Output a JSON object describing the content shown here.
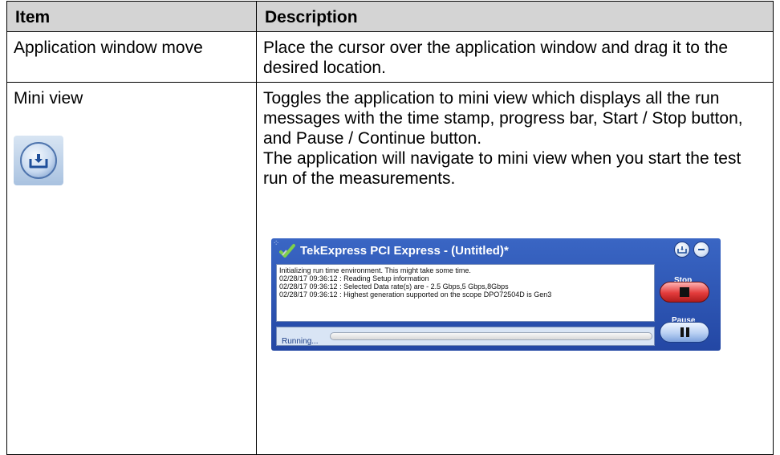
{
  "table": {
    "headers": [
      "Item",
      "Description"
    ],
    "rows": [
      {
        "item": "Application window move",
        "description": [
          "Place the cursor over the application window and drag it to the desired location."
        ]
      },
      {
        "item": "Mini view",
        "description": [
          "Toggles the application to mini view which displays all the run messages with the time stamp, progress bar, Start / Stop button, and Pause / Continue button.",
          "The application will navigate to mini view when you start the test run of the measurements."
        ]
      }
    ]
  },
  "mini_view": {
    "title": "TekExpress PCI Express  -  (Untitled)*",
    "messages": [
      "Initializing run time environment. This might take some time.",
      "02/28/17 09:36:12 : Reading Setup information",
      "02/28/17 09:36:12 : Selected Data rate(s) are - 2.5 Gbps,5 Gbps,8Gbps",
      "02/28/17 09:36:12 : Highest generation supported on the scope DPO72504D is Gen3"
    ],
    "stop_label": "Stop",
    "pause_label": "Pause",
    "status": "Running...",
    "progress": 0
  },
  "colors": {
    "header_bg": "#d4d4d4",
    "window_bg": "#2f59b8",
    "stop_button": "#e33c3c",
    "pause_button": "#b9d0f3"
  }
}
